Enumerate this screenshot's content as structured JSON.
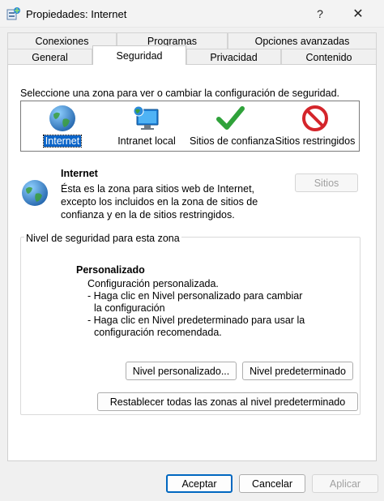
{
  "window": {
    "title": "Propiedades: Internet",
    "help_glyph": "?",
    "close_glyph": "✕"
  },
  "tabs": {
    "row1": [
      "Conexiones",
      "Programas",
      "Opciones avanzadas"
    ],
    "row2": [
      "General",
      "Seguridad",
      "Privacidad",
      "Contenido"
    ],
    "active": "Seguridad"
  },
  "zones": {
    "intro": "Seleccione una zona para ver o cambiar la configuración de seguridad.",
    "items": [
      {
        "label": "Internet",
        "icon": "globe-icon",
        "selected": true
      },
      {
        "label": "Intranet local",
        "icon": "monitor-globe-icon",
        "selected": false
      },
      {
        "label": "Sitios de confianza",
        "icon": "checkmark-icon",
        "selected": false
      },
      {
        "label": "Sitios restringidos",
        "icon": "no-entry-icon",
        "selected": false
      }
    ]
  },
  "zone_info": {
    "title": "Internet",
    "description": "Ésta es la zona para sitios web de Internet, excepto los incluidos en la zona de sitios de confianza y en la de sitios restringidos.",
    "sites_button": "Sitios"
  },
  "security_level": {
    "group_label": "Nivel de seguridad para esta zona",
    "title": "Personalizado",
    "lines": [
      "Configuración personalizada.",
      "- Haga clic en Nivel personalizado para cambiar",
      "la configuración",
      "- Haga clic en Nivel predeterminado para usar la",
      "configuración recomendada."
    ],
    "custom_button": "Nivel personalizado...",
    "default_button": "Nivel predeterminado"
  },
  "reset_button": "Restablecer todas las zonas al nivel predeterminado",
  "footer": {
    "ok": "Aceptar",
    "cancel": "Cancelar",
    "apply": "Aplicar"
  },
  "colors": {
    "selection": "#0a64c8",
    "default_button_border": "#0067c0",
    "check_green": "#2fa23a",
    "restricted_red": "#d4252b"
  }
}
